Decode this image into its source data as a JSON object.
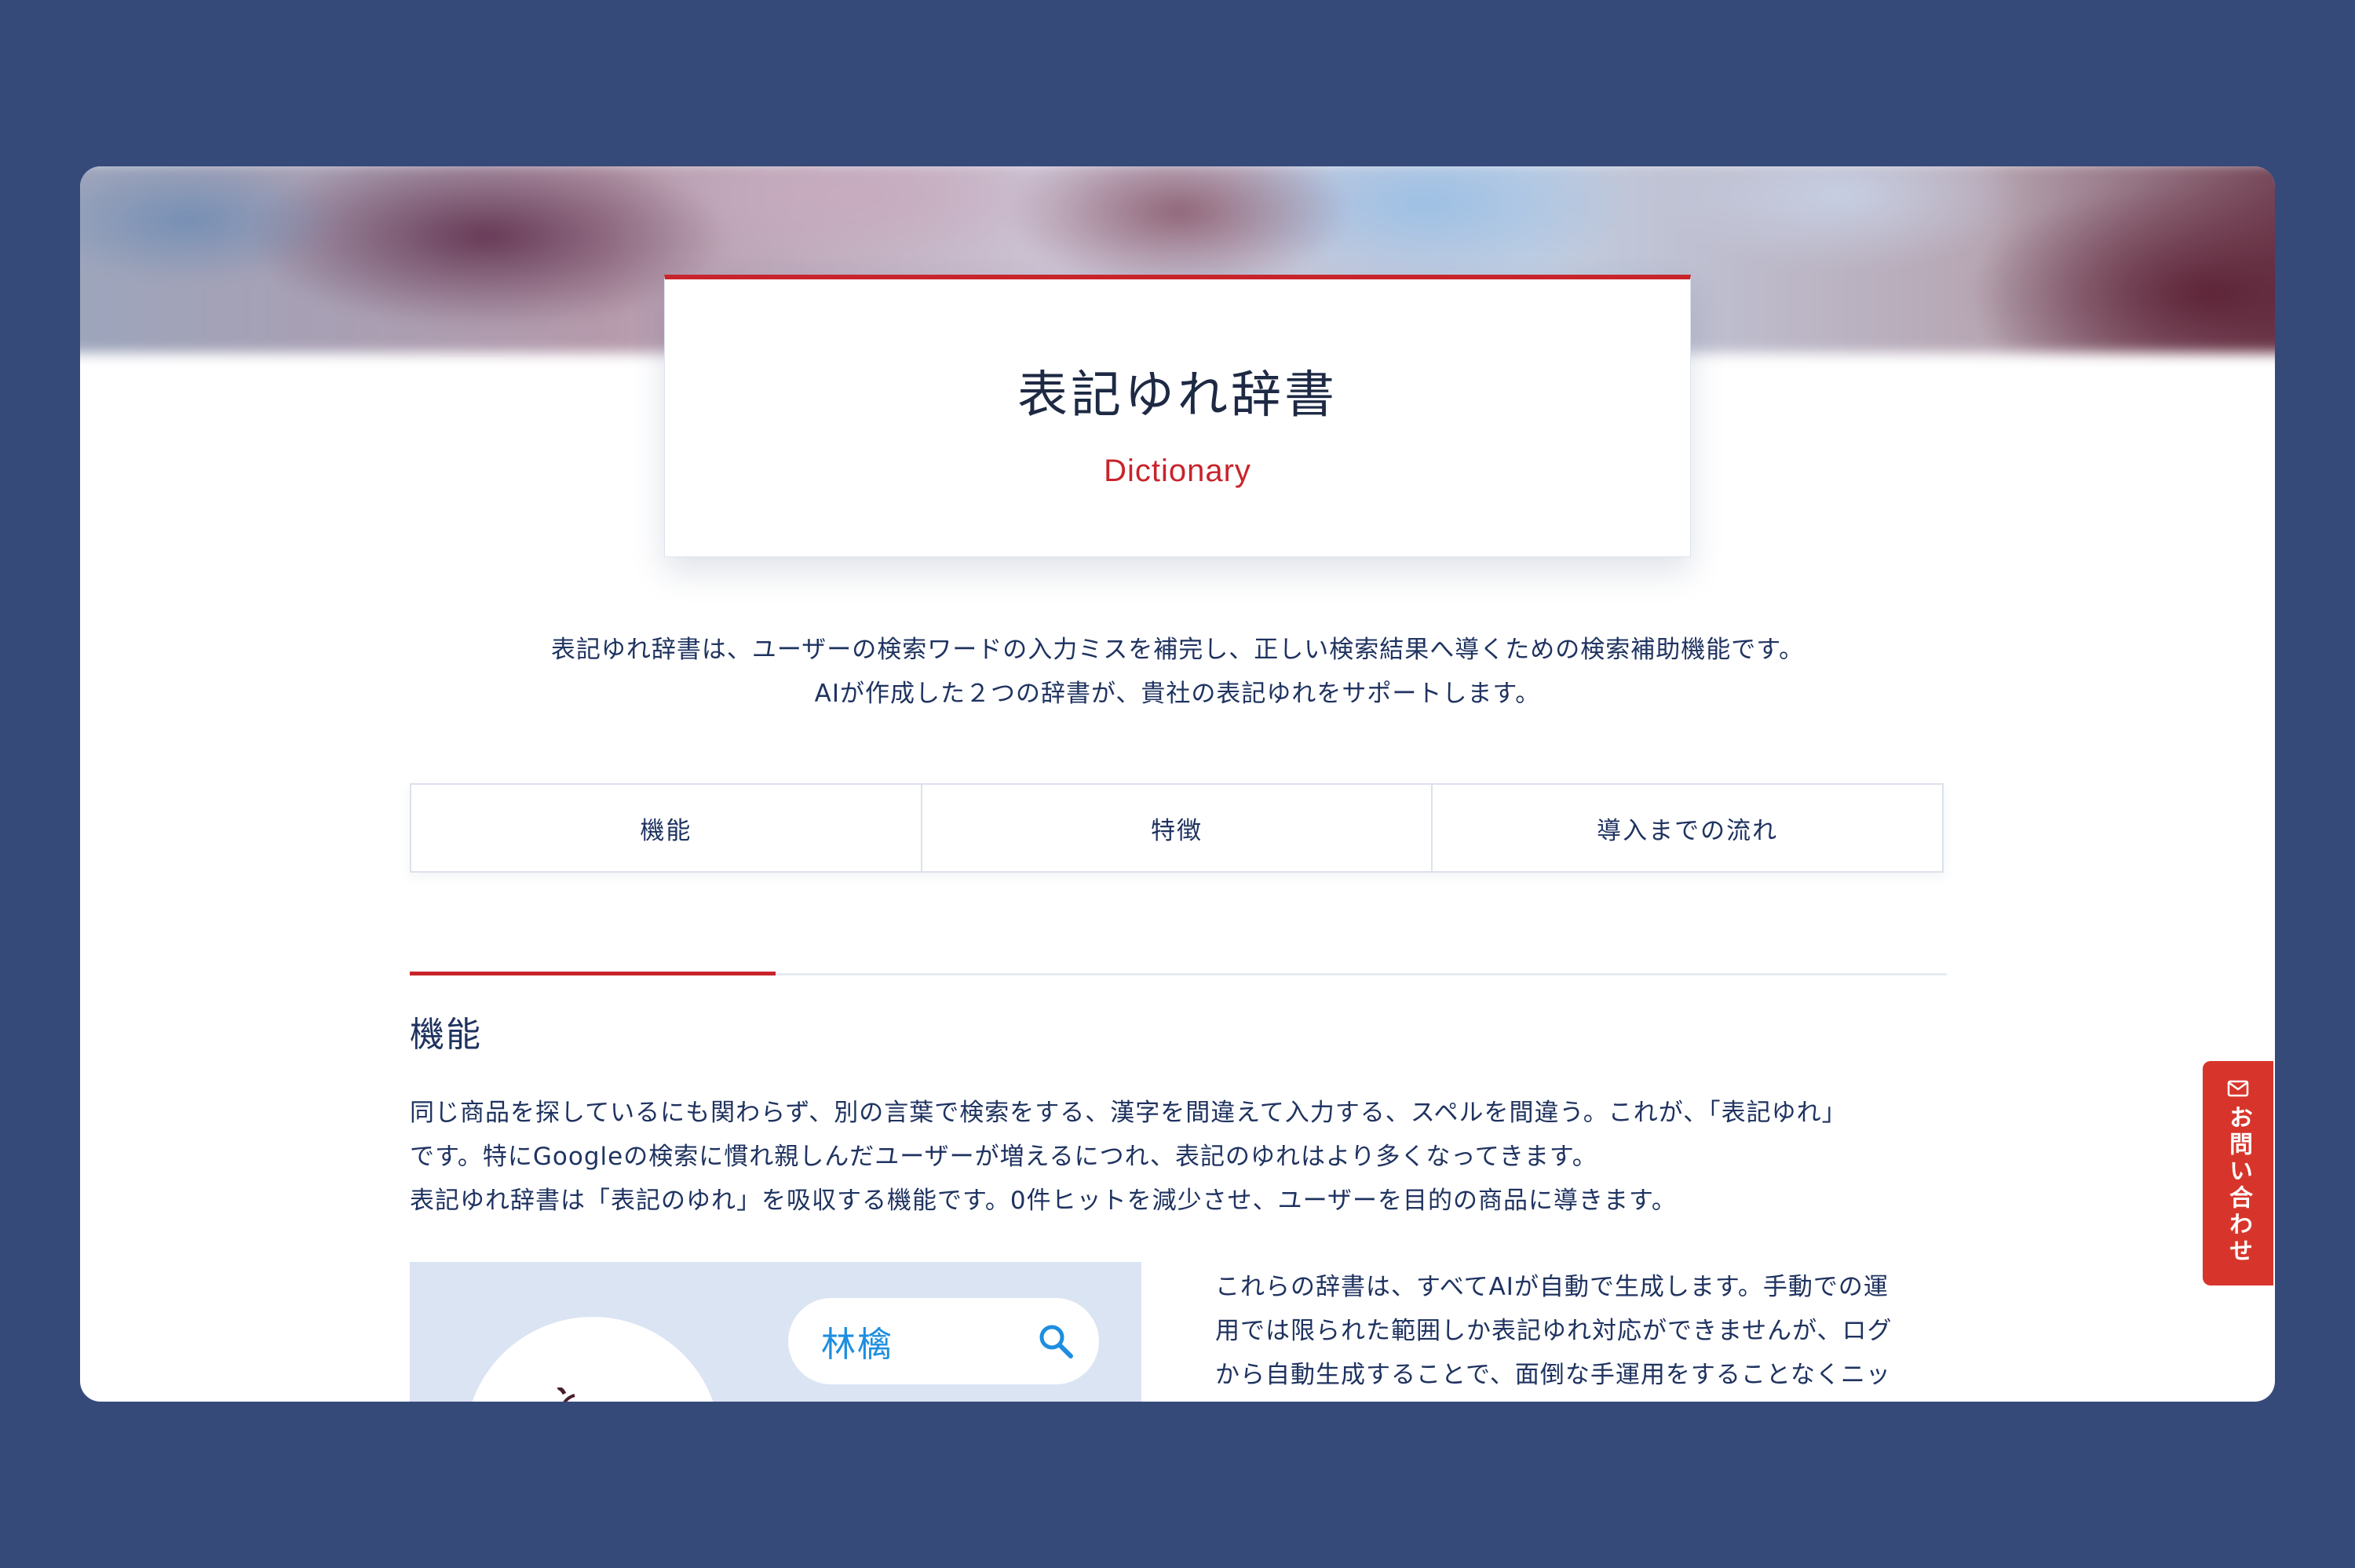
{
  "hero": {
    "title": "表記ゆれ辞書",
    "subtitle": "Dictionary"
  },
  "intro": {
    "line1": "表記ゆれ辞書は、ユーザーの検索ワードの入力ミスを補完し、正しい検索結果へ導くための検索補助機能です。",
    "line2": "AIが作成した２つの辞書が、貴社の表記ゆれをサポートします。"
  },
  "tabs": [
    {
      "label": "機能"
    },
    {
      "label": "特徴"
    },
    {
      "label": "導入までの流れ"
    }
  ],
  "section": {
    "title": "機能",
    "paragraph_line1": "同じ商品を探しているにも関わらず、別の言葉で検索をする、漢字を間違えて入力する、スペルを間違う。これが、「表記ゆれ」",
    "paragraph_line2": "です。特にGoogleの検索に慣れ親しんだユーザーが増えるにつれ、表記のゆれはより多くなってきます。",
    "paragraph_line3": "表記ゆれ辞書は「表記のゆれ」を吸収する機能です。0件ヒットを減少させ、ユーザーを目的の商品に導きます。",
    "illustration_query": "林檎",
    "side_line1": "これらの辞書は、すべてAIが自動で生成します。手動での運",
    "side_line2": "用では限られた範囲しか表記ゆれ対応ができませんが、ログ",
    "side_line3": "から自動生成することで、面倒な手運用をすることなくニッ"
  },
  "contact_button": {
    "label": "お問い合わせ",
    "icon": "mail-icon"
  },
  "colors": {
    "background": "#364a7a",
    "accent_red": "#c8242c",
    "text_navy": "#1f3360",
    "search_blue": "#1d8ee0",
    "illustration_bg": "#dbe4f3"
  }
}
